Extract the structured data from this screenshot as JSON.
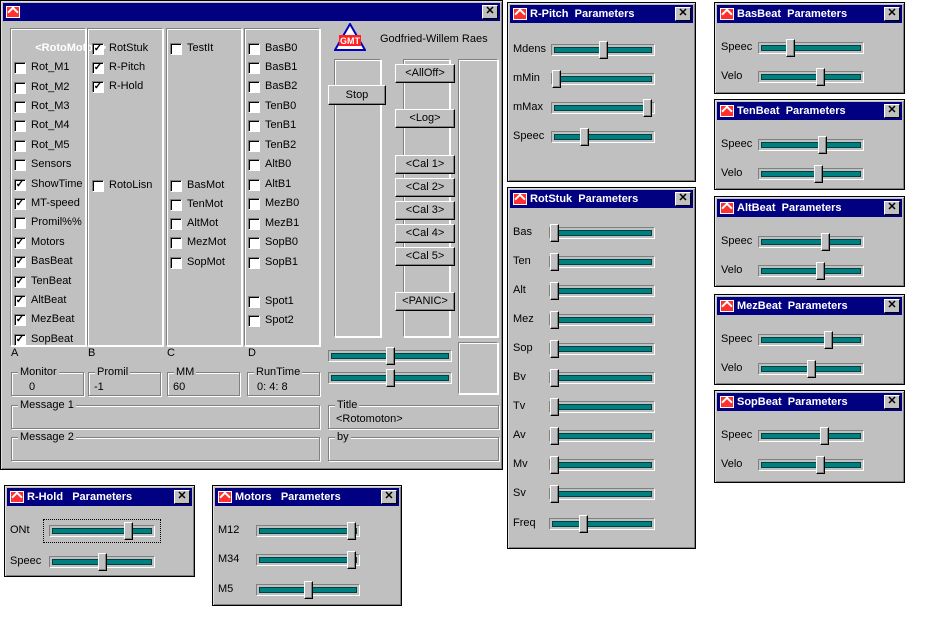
{
  "main": {
    "title": "<RotoMoton>",
    "author": "Godfried-Willem Raes",
    "col1": [
      "Rot_M1",
      "Rot_M2",
      "Rot_M3",
      "Rot_M4",
      "Rot_M5",
      "Sensors",
      "ShowTime",
      "MT-speed",
      "Promil%%",
      "Motors",
      "BasBeat",
      "TenBeat",
      "AltBeat",
      "MezBeat",
      "SopBeat"
    ],
    "col1_checked": [
      false,
      false,
      false,
      false,
      false,
      false,
      true,
      true,
      false,
      true,
      true,
      true,
      true,
      true,
      true
    ],
    "col2": [
      "RotStuk",
      "R-Pitch",
      "R-Hold",
      "RotoLisn"
    ],
    "col2_checked": [
      true,
      true,
      true,
      false
    ],
    "col3": [
      "TestIt",
      "BasMot",
      "TenMot",
      "AltMot",
      "MezMot",
      "SopMot"
    ],
    "col4": [
      "BasB0",
      "BasB1",
      "BasB2",
      "TenB0",
      "TenB1",
      "TenB2",
      "AltB0",
      "AltB1",
      "MezB0",
      "MezB1",
      "SopB0",
      "SopB1",
      "Spot1",
      "Spot2"
    ],
    "col_letters": [
      "A",
      "B",
      "C",
      "D"
    ],
    "stop_label": "Stop",
    "buttons": [
      "<AllOff>",
      "<Log>",
      "<Cal 1>",
      "<Cal 2>",
      "<Cal 3>",
      "<Cal 4>",
      "<Cal 5>",
      "<PANIC>"
    ],
    "monitor_label": "Monitor",
    "monitor_value": "0",
    "promil_label": "Promil",
    "promil_value": "-1",
    "mm_label": "MM",
    "mm_value": "60",
    "runtime_label": "RunTime",
    "runtime_value": "0: 4: 8",
    "message1_label": "Message 1",
    "message2_label": "Message 2",
    "title_label": "Title",
    "title_value": "<Rotomoton>",
    "by_label": "by",
    "sliders": [
      0.5,
      0.5
    ]
  },
  "rpitch": {
    "title": "R-Pitch  Parameters",
    "labels": [
      "Mdens",
      "mMin",
      "mMax",
      "Speec"
    ],
    "values": [
      0.5,
      0.0,
      0.98,
      0.3
    ]
  },
  "rotstuk": {
    "title": "RotStuk  Parameters",
    "labels": [
      "Bas",
      "Ten",
      "Alt",
      "Mez",
      "Sop",
      "Bv",
      "Tv",
      "Av",
      "Mv",
      "Sv",
      "Freq"
    ],
    "values": [
      0,
      0,
      0,
      0,
      0,
      0,
      0,
      0,
      0,
      0,
      0.3
    ]
  },
  "rhold": {
    "title": "R-Hold   Parameters",
    "labels": [
      "ONt",
      "Speec"
    ],
    "values": [
      0.78,
      0.5
    ]
  },
  "motors": {
    "title": "Motors   Parameters",
    "labels": [
      "M12",
      "M34",
      "M5"
    ],
    "values": [
      0.97,
      0.97,
      0.5
    ]
  },
  "basbeat": {
    "title": "BasBeat  Parameters",
    "labels": [
      "Speec",
      "Velo"
    ],
    "values": [
      0.28,
      0.6
    ]
  },
  "tenbeat": {
    "title": "TenBeat  Parameters",
    "labels": [
      "Speec",
      "Velo"
    ],
    "values": [
      0.62,
      0.58
    ]
  },
  "altbeat": {
    "title": "AltBeat  Parameters",
    "labels": [
      "Speec",
      "Velo"
    ],
    "values": [
      0.65,
      0.6
    ]
  },
  "mezbeat": {
    "title": "MezBeat  Parameters",
    "labels": [
      "Speec",
      "Velo"
    ],
    "values": [
      0.68,
      0.5
    ]
  },
  "sopbeat": {
    "title": "SopBeat  Parameters",
    "labels": [
      "Speec",
      "Velo"
    ],
    "values": [
      0.64,
      0.6
    ]
  },
  "close_glyph": "✕"
}
